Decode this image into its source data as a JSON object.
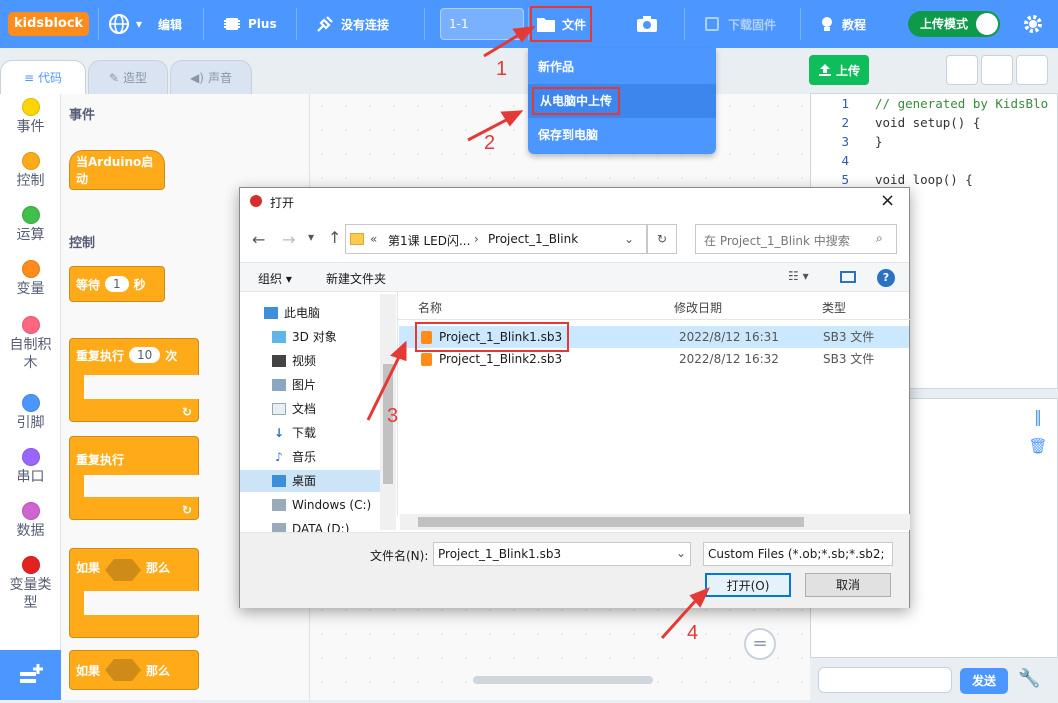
{
  "topbar": {
    "logo": "kidsblock",
    "edit_label": "编辑",
    "plus_label": "Plus",
    "connection_label": "没有连接",
    "project_name": "1-1",
    "file_label": "文件",
    "download_firmware_label": "下载固件",
    "tutorial_label": "教程",
    "upload_mode_label": "上传模式"
  },
  "file_menu": [
    "新作品",
    "从电脑中上传",
    "保存到电脑"
  ],
  "tabs": [
    "代码",
    "造型",
    "声音"
  ],
  "categories": [
    {
      "label": "事件",
      "color": "#ffd500"
    },
    {
      "label": "控制",
      "color": "#ffab19"
    },
    {
      "label": "运算",
      "color": "#40bf4a"
    },
    {
      "label": "变量",
      "color": "#ff8c1a"
    },
    {
      "label": "自制积木",
      "color": "#ff6680"
    },
    {
      "label": "引脚",
      "color": "#4c97ff"
    },
    {
      "label": "串口",
      "color": "#9966ff"
    },
    {
      "label": "数据",
      "color": "#cf63cf"
    },
    {
      "label": "变量类型",
      "color": "#e52222"
    }
  ],
  "palette": {
    "events_header": "事件",
    "when_arduino_start": "当Arduino启动",
    "control_header": "控制",
    "wait_label": "等待",
    "wait_value": "1",
    "wait_unit": "秒",
    "repeat_label": "重复执行",
    "repeat_value": "10",
    "repeat_unit": "次",
    "forever_label": "重复执行",
    "if_label": "如果",
    "then_label": "那么",
    "if2_label": "如果",
    "then2_label": "那么"
  },
  "right_panel": {
    "upload_label": "上传",
    "code_lines": [
      {
        "n": "1",
        "text": "// generated by KidsBlo"
      },
      {
        "n": "2",
        "text": "void setup() {"
      },
      {
        "n": "3",
        "text": "}"
      },
      {
        "n": "4",
        "text": ""
      },
      {
        "n": "5",
        "text": "void loop() {"
      }
    ],
    "send_label": "发送"
  },
  "dialog": {
    "title": "打开",
    "path_prefix": "«",
    "path_1": "第1课 LED闪...",
    "path_2": "Project_1_Blink",
    "search_placeholder": "在 Project_1_Blink 中搜索",
    "organize_label": "组织 ▾",
    "new_folder_label": "新建文件夹",
    "tree": [
      "此电脑",
      "3D 对象",
      "视频",
      "图片",
      "文档",
      "下载",
      "音乐",
      "桌面",
      "Windows (C:)",
      "DATA (D:)"
    ],
    "columns": {
      "name": "名称",
      "date": "修改日期",
      "type": "类型"
    },
    "files": [
      {
        "name": "Project_1_Blink1.sb3",
        "date": "2022/8/12 16:31",
        "type": "SB3 文件"
      },
      {
        "name": "Project_1_Blink2.sb3",
        "date": "2022/8/12 16:32",
        "type": "SB3 文件"
      }
    ],
    "filename_label": "文件名(N):",
    "filename_value": "Project_1_Blink1.sb3",
    "filter_value": "Custom Files (*.ob;*.sb;*.sb2;",
    "open_label": "打开(O)",
    "cancel_label": "取消"
  },
  "annotations": [
    "1",
    "2",
    "3",
    "4"
  ]
}
